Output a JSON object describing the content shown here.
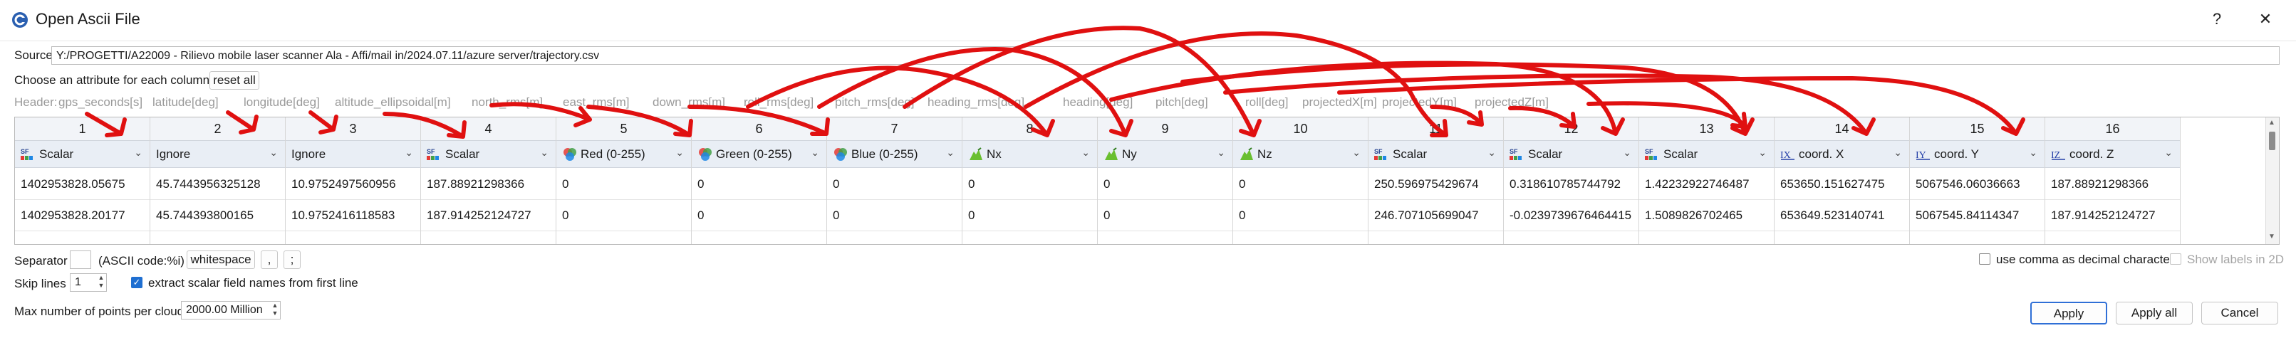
{
  "window": {
    "title": "Open Ascii File",
    "help": "?",
    "close": "✕"
  },
  "source": {
    "label": "Source",
    "path": "Y:/PROGETTI/A22009 - Rilievo mobile laser scanner Ala - Affi/mail in/2024.07.11/azure server/trajectory.csv"
  },
  "attributes": {
    "label": "Choose an attribute for each column:",
    "reset_button": "reset all"
  },
  "header_line": {
    "prefix": "Header:",
    "fields": [
      "gps_seconds[s]",
      "latitude[deg]",
      "longitude[deg]",
      "altitude_ellipsoidal[m]",
      "north_rms[m]",
      "east_rms[m]",
      "down_rms[m]",
      "roll_rms[deg]",
      "pitch_rms[deg]",
      "heading_rms[deg]",
      "heading[deg]",
      "pitch[deg]",
      "roll[deg]",
      "projectedX[m]",
      "projectedY[m]",
      "projectedZ[m]"
    ]
  },
  "columns": [
    {
      "number": "1",
      "type": "Scalar",
      "icon": "scalar-field-icon",
      "values": [
        "1402953828.05675",
        "1402953828.20177"
      ]
    },
    {
      "number": "2",
      "type": "Ignore",
      "icon": "",
      "values": [
        "45.7443956325128",
        "45.744393800165"
      ]
    },
    {
      "number": "3",
      "type": "Ignore",
      "icon": "",
      "values": [
        "10.9752497560956",
        "10.9752416118583"
      ]
    },
    {
      "number": "4",
      "type": "Scalar",
      "icon": "scalar-field-icon",
      "values": [
        "187.88921298366",
        "187.914252124727"
      ]
    },
    {
      "number": "5",
      "type": "Red (0-255)",
      "icon": "rgb-icon",
      "values": [
        "0",
        "0"
      ]
    },
    {
      "number": "6",
      "type": "Green (0-255)",
      "icon": "rgb-icon",
      "values": [
        "0",
        "0"
      ]
    },
    {
      "number": "7",
      "type": "Blue (0-255)",
      "icon": "rgb-icon",
      "values": [
        "0",
        "0"
      ]
    },
    {
      "number": "8",
      "type": "Nx",
      "icon": "normal-icon",
      "values": [
        "0",
        "0"
      ]
    },
    {
      "number": "9",
      "type": "Ny",
      "icon": "normal-icon",
      "values": [
        "0",
        "0"
      ]
    },
    {
      "number": "10",
      "type": "Nz",
      "icon": "normal-icon",
      "values": [
        "0",
        "0"
      ]
    },
    {
      "number": "11",
      "type": "Scalar",
      "icon": "scalar-field-icon",
      "values": [
        "250.596975429674",
        "246.707105699047"
      ]
    },
    {
      "number": "12",
      "type": "Scalar",
      "icon": "scalar-field-icon",
      "values": [
        "0.318610785744792",
        "-0.0239739676464415"
      ]
    },
    {
      "number": "13",
      "type": "Scalar",
      "icon": "scalar-field-icon",
      "values": [
        "1.42232922746487",
        "1.5089826702465"
      ]
    },
    {
      "number": "14",
      "type": "coord. X",
      "icon": "coord-x-icon",
      "values": [
        "653650.15162747​5",
        "653649.523140741"
      ]
    },
    {
      "number": "15",
      "type": "coord. Y",
      "icon": "coord-y-icon",
      "values": [
        "5067546.06036663",
        "5067545.84114347"
      ]
    },
    {
      "number": "16",
      "type": "coord. Z",
      "icon": "coord-z-icon",
      "values": [
        "187.88921298366",
        "187.914252124727"
      ]
    }
  ],
  "options": {
    "separator_label": "Separator",
    "ascii_code_label": "(ASCII code:%i)",
    "whitespace_button": "whitespace",
    "comma_button": ",",
    "semicolon_button": ";",
    "skip_lines_label": "Skip lines",
    "skip_lines_value": "1",
    "extract_names_label": "extract scalar field names from first line",
    "max_points_label": "Max number of points per cloud",
    "max_points_value": "2000.00 Million",
    "comma_decimal_label": "use comma as decimal character",
    "show_labels_2d_label": "Show labels in 2D"
  },
  "buttons": {
    "apply": "Apply",
    "apply_all": "Apply all",
    "cancel": "Cancel"
  },
  "colors": {
    "accent": "#2f6fd6",
    "annotation": "#e01010"
  }
}
